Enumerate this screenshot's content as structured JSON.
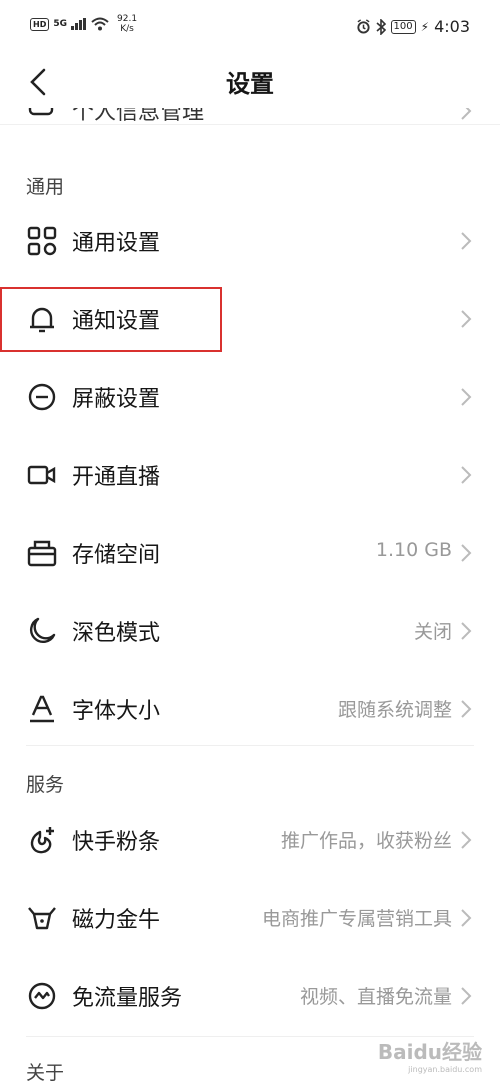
{
  "status_bar": {
    "network_badge": "HD",
    "signal": "5G",
    "speed_value": "92.1",
    "speed_unit": "K/s",
    "battery": "100",
    "time": "4:03"
  },
  "header": {
    "title": "设置"
  },
  "partial_item": {
    "label": "个人信息管理"
  },
  "sections": {
    "general": "通用",
    "services": "服务",
    "about": "关于"
  },
  "rows": [
    {
      "label": "通用设置",
      "value": "",
      "icon": "grid-icon"
    },
    {
      "label": "通知设置",
      "value": "",
      "icon": "bell-icon"
    },
    {
      "label": "屏蔽设置",
      "value": "",
      "icon": "block-icon"
    },
    {
      "label": "开通直播",
      "value": "",
      "icon": "video-camera-icon"
    },
    {
      "label": "存储空间",
      "value": "1.10 GB",
      "icon": "storage-icon"
    },
    {
      "label": "深色模式",
      "value": "关闭",
      "icon": "moon-icon"
    },
    {
      "label": "字体大小",
      "value": "跟随系统调整",
      "icon": "font-size-icon"
    },
    {
      "label": "快手粉条",
      "value": "推广作品，收获粉丝",
      "icon": "fan-promo-icon"
    },
    {
      "label": "磁力金牛",
      "value": "电商推广专属营销工具",
      "icon": "bull-icon"
    },
    {
      "label": "免流量服务",
      "value": "视频、直播免流量",
      "icon": "free-data-icon"
    }
  ],
  "watermark": {
    "text": "Baidu经验",
    "sub": "jingyan.baidu.com"
  }
}
